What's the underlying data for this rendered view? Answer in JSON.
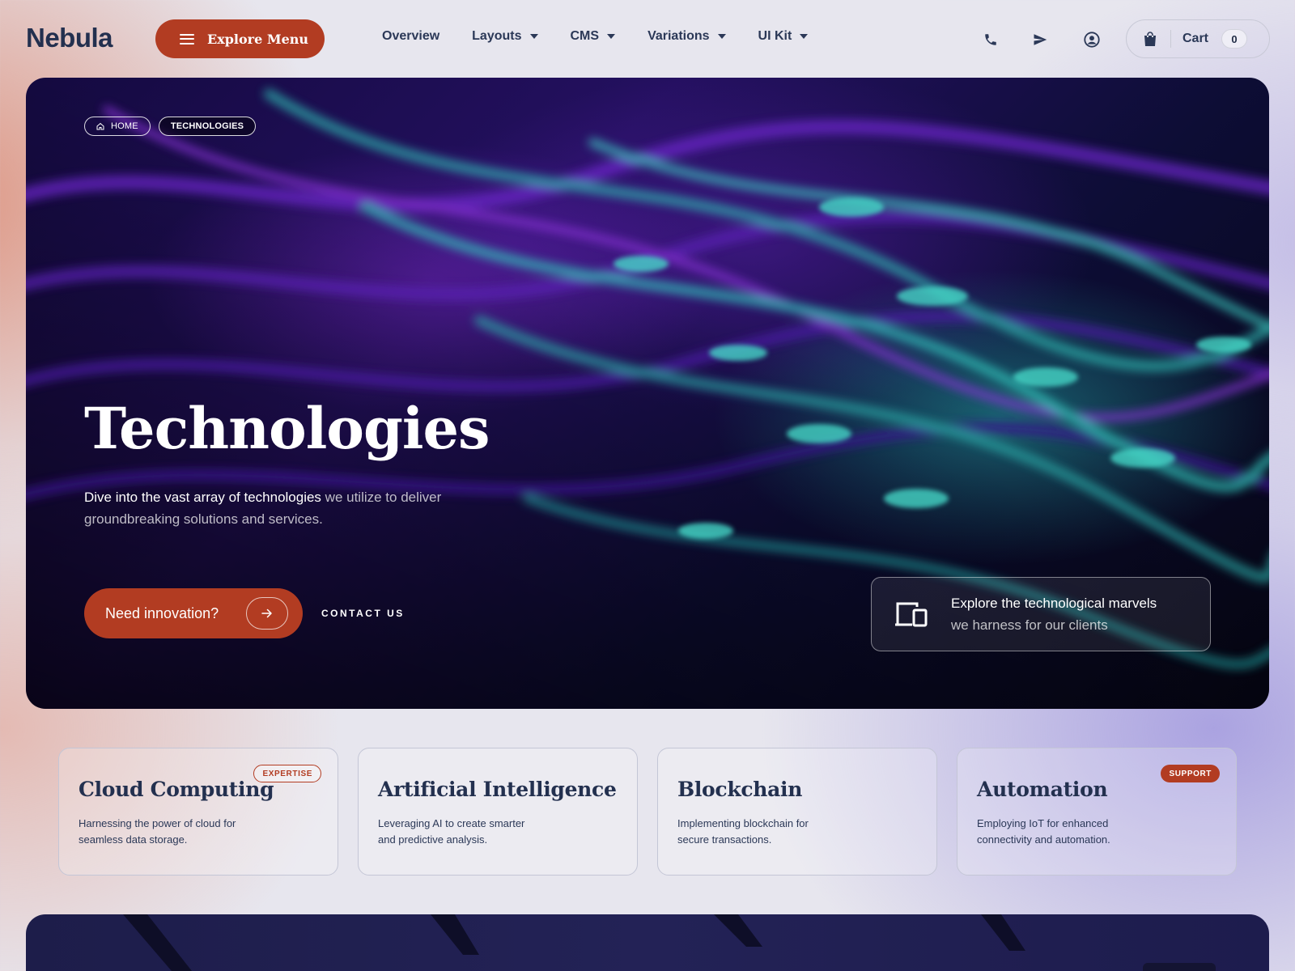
{
  "header": {
    "logo": "Nebula",
    "explore_menu_label": "Explore Menu",
    "nav": [
      {
        "label": "Overview",
        "has_dropdown": false
      },
      {
        "label": "Layouts",
        "has_dropdown": true
      },
      {
        "label": "CMS",
        "has_dropdown": true
      },
      {
        "label": "Variations",
        "has_dropdown": true
      },
      {
        "label": "UI Kit",
        "has_dropdown": true
      }
    ],
    "icons": [
      "phone-icon",
      "send-icon",
      "user-icon"
    ],
    "cart": {
      "label": "Cart",
      "count": "0",
      "icon": "shopping-bag-icon"
    }
  },
  "hero": {
    "breadcrumbs": [
      {
        "label": "HOME",
        "icon": "home-icon"
      },
      {
        "label": "TECHNOLOGIES"
      }
    ],
    "title": "Technologies",
    "description_strong": "Dive into the vast array of technologies",
    "description_rest": " we utilize to deliver groundbreaking solutions and services.",
    "cta_label": "Need innovation?",
    "cta_icon": "arrow-right-icon",
    "contact_label": "CONTACT US",
    "marvel": {
      "icon": "devices-icon",
      "line1": "Explore the technological marvels",
      "line2": "we harness for our clients"
    }
  },
  "cards": [
    {
      "title": "Cloud Computing",
      "description": "Harnessing the power of cloud for seamless data storage.",
      "badge": "EXPERTISE"
    },
    {
      "title": "Artificial Intelligence",
      "description": "Leveraging AI to create smarter and predictive analysis.",
      "badge": ""
    },
    {
      "title": "Blockchain",
      "description": "Implementing blockchain for secure transactions.",
      "badge": ""
    },
    {
      "title": "Automation",
      "description": "Employing IoT for enhanced connectivity and automation.",
      "badge": "SUPPORT"
    }
  ],
  "colors": {
    "accent": "#b23c22",
    "text_dark": "#23304f",
    "hero_bg": "#140a40",
    "hero_glow_teal": "#28c8be",
    "hero_glow_violet": "#7828c8"
  }
}
